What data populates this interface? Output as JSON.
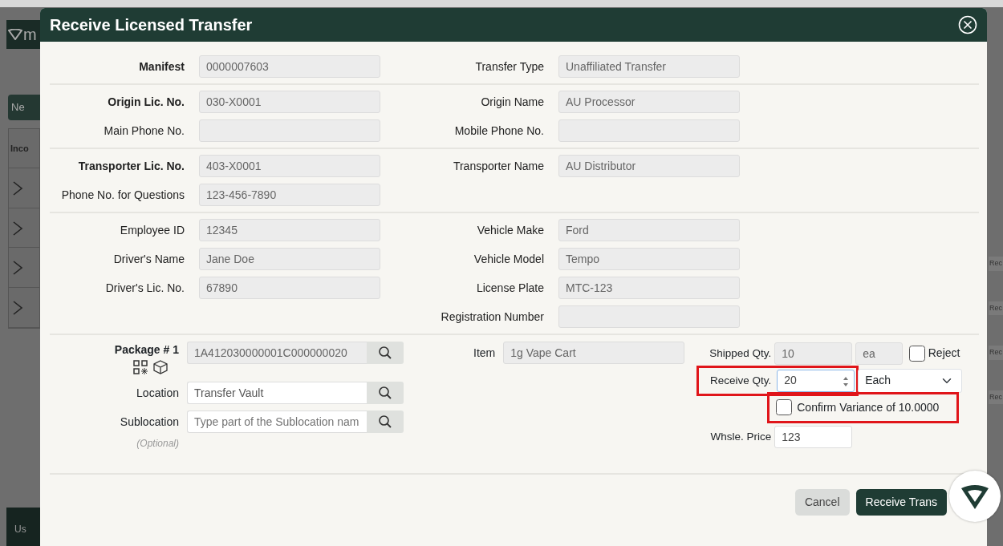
{
  "background_app": {
    "logo_text": "m",
    "new_button": "Ne",
    "panel_tab": "Inco",
    "footer_text": "Us",
    "right_labels": [
      "Rec",
      "Rec",
      "Rec",
      "Rec"
    ]
  },
  "dialog": {
    "title": "Receive Licensed Transfer",
    "sections": [
      {
        "left": [
          {
            "label": "Manifest",
            "bold": true,
            "value": "0000007603"
          }
        ],
        "right": [
          {
            "label": "Transfer Type",
            "bold": false,
            "value": "Unaffiliated Transfer"
          }
        ]
      },
      {
        "left": [
          {
            "label": "Origin Lic. No.",
            "bold": true,
            "value": "030-X0001"
          },
          {
            "label": "Main Phone No.",
            "bold": false
          }
        ],
        "right": [
          {
            "label": "Origin Name",
            "bold": false,
            "value": "AU Processor"
          },
          {
            "label": "Mobile Phone No.",
            "bold": false
          }
        ]
      },
      {
        "left": [
          {
            "label": "Transporter Lic. No.",
            "bold": true,
            "value": "403-X0001"
          },
          {
            "label": "Phone No. for Questions",
            "bold": false,
            "value": "123-456-7890"
          }
        ],
        "right": [
          {
            "label": "Transporter Name",
            "bold": false,
            "value": "AU Distributor"
          }
        ]
      },
      {
        "left": [
          {
            "label": "Employee ID",
            "bold": false,
            "value": "12345"
          },
          {
            "label": "Driver's Name",
            "bold": false,
            "value": "Jane Doe"
          },
          {
            "label": "Driver's Lic. No.",
            "bold": false,
            "value": "67890"
          }
        ],
        "right": [
          {
            "label": "Vehicle Make",
            "bold": false,
            "value": "Ford"
          },
          {
            "label": "Vehicle Model",
            "bold": false,
            "value": "Tempo"
          },
          {
            "label": "License Plate",
            "bold": false,
            "value": "MTC-123"
          },
          {
            "label": "Registration Number",
            "bold": false
          }
        ]
      }
    ],
    "package": {
      "label": "Package # 1",
      "package_value": "1A412030000001C000000020",
      "location_label": "Location",
      "location_value": "Transfer Vault",
      "sublocation_label": "Sublocation",
      "sublocation_placeholder": "Type part of the Sublocation nam",
      "optional_note": "(Optional)",
      "item_label": "Item",
      "item_value": "1g Vape Cart",
      "shipped_label": "Shipped Qty.",
      "shipped_value": "10",
      "shipped_unit": "ea",
      "reject_label": "Reject",
      "reject_checked": false,
      "receive_label": "Receive Qty.",
      "receive_value": "20",
      "receive_highlighted": true,
      "unit_value": "Each",
      "variance_label": "Confirm Variance of 10.0000",
      "variance_checked": false,
      "variance_highlighted": true,
      "price_label": "Whsle. Price",
      "price_value": "123"
    },
    "buttons": [
      {
        "label": "Cancel",
        "kind": "secondary"
      },
      {
        "label": "Receive Trans",
        "kind": "primary"
      }
    ]
  }
}
